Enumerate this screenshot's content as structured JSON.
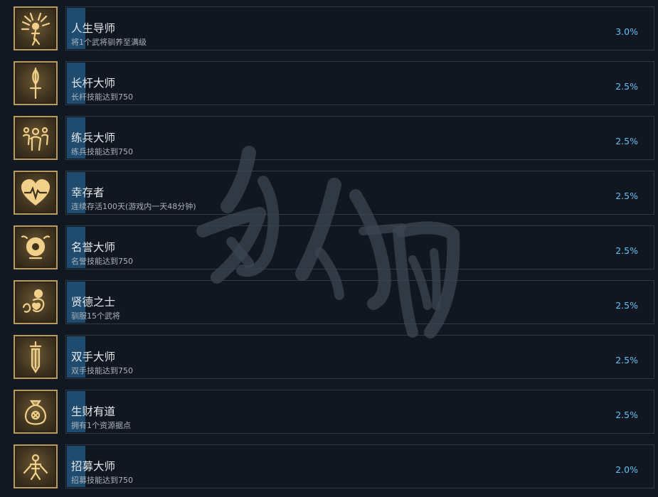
{
  "achievements": [
    {
      "title": "人生导师",
      "desc": "将1个武将驯养至满级",
      "pct": "3.0%",
      "icon": "mentor-icon",
      "progress": 0.03
    },
    {
      "title": "长杆大师",
      "desc": "长杆技能达到750",
      "pct": "2.5%",
      "icon": "polearm-icon",
      "progress": 0.025
    },
    {
      "title": "练兵大师",
      "desc": "练兵技能达到750",
      "pct": "2.5%",
      "icon": "troops-icon",
      "progress": 0.025
    },
    {
      "title": "幸存者",
      "desc": "连续存活100天(游戏内一天48分钟)",
      "pct": "2.5%",
      "icon": "heart-icon",
      "progress": 0.025
    },
    {
      "title": "名誉大师",
      "desc": "名誉技能达到750",
      "pct": "2.5%",
      "icon": "renown-icon",
      "progress": 0.025
    },
    {
      "title": "贤德之士",
      "desc": "驯服15个武将",
      "pct": "2.5%",
      "icon": "virtue-icon",
      "progress": 0.025
    },
    {
      "title": "双手大师",
      "desc": "双手技能达到750",
      "pct": "2.5%",
      "icon": "two-handed-sword-icon",
      "progress": 0.025
    },
    {
      "title": "生财有道",
      "desc": "拥有1个资源据点",
      "pct": "2.5%",
      "icon": "money-bag-icon",
      "progress": 0.025
    },
    {
      "title": "招募大师",
      "desc": "招募技能达到750",
      "pct": "2.0%",
      "icon": "recruit-icon",
      "progress": 0.02
    }
  ],
  "watermark": "游侠网",
  "colors": {
    "background": "#121821",
    "panel_border": "#2c3a4a",
    "progress": "#1f4c6e",
    "percent": "#66c0f4",
    "icon_frame": "#b89a5e"
  }
}
